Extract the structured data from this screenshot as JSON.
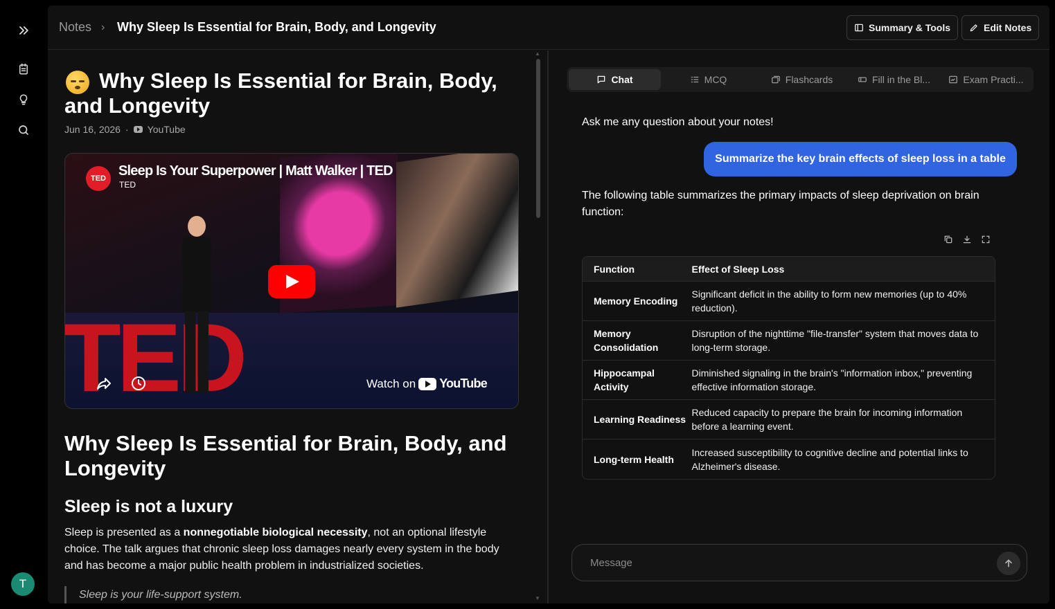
{
  "nav": {
    "icons": [
      "chevrons-right-icon",
      "notes-icon",
      "lightbulb-icon",
      "search-icon"
    ],
    "avatar_initial": "T"
  },
  "header": {
    "breadcrumb_root": "Notes",
    "breadcrumb_sep": "›",
    "breadcrumb_title": "Why Sleep Is Essential for Brain, Body, and Longevity",
    "summary_button": "Summary & Tools",
    "edit_button": "Edit Notes"
  },
  "note": {
    "title": "Why Sleep Is Essential for Brain, Body, and Longevity",
    "date": "Jun 16, 2026",
    "dot": "·",
    "source": "YouTube",
    "video": {
      "title": "Sleep Is Your Superpower | Matt Walker | TED",
      "channel": "TED",
      "logo": "TED",
      "stage_text": "TED",
      "watch_on": "Watch on",
      "youtube": "YouTube"
    },
    "heading": "Why Sleep Is Essential for Brain, Body, and Longevity",
    "subheading": "Sleep is not a luxury",
    "para_pre": "Sleep is presented as a ",
    "para_bold": "nonnegotiable biological necessity",
    "para_post": ", not an optional lifestyle choice. The talk argues that chronic sleep loss damages nearly every system in the body and has become a major public health problem in industrialized societies.",
    "quote": "Sleep is your life-support system."
  },
  "tools": {
    "tabs": [
      {
        "label": "Chat",
        "icon": "chat-icon",
        "active": true
      },
      {
        "label": "MCQ",
        "icon": "list-icon",
        "active": false
      },
      {
        "label": "Flashcards",
        "icon": "cards-icon",
        "active": false
      },
      {
        "label": "Fill in the Bl...",
        "icon": "blank-icon",
        "active": false
      },
      {
        "label": "Exam Practi...",
        "icon": "exam-icon",
        "active": false
      }
    ],
    "chat": {
      "prompt": "Ask me any question about your notes!",
      "user_message": "Summarize the key brain effects of sleep loss in a table",
      "answer": "The following table summarizes the primary impacts of sleep deprivation on brain function:",
      "table": {
        "headers": [
          "Function",
          "Effect of Sleep Loss"
        ],
        "rows": [
          [
            "Memory Encoding",
            "Significant deficit in the ability to form new memories (up to 40% reduction)."
          ],
          [
            "Memory Consolidation",
            "Disruption of the nighttime \"file-transfer\" system that moves data to long-term storage."
          ],
          [
            "Hippocampal Activity",
            "Diminished signaling in the brain's \"information inbox,\" preventing effective information storage."
          ],
          [
            "Learning Readiness",
            "Reduced capacity to prepare the brain for incoming information before a learning event."
          ],
          [
            "Long-term Health",
            "Increased susceptibility to cognitive decline and potential links to Alzheimer's disease."
          ]
        ]
      },
      "message_placeholder": "Message"
    }
  },
  "colors": {
    "accent": "#3164e1",
    "avatar": "#1a8a73",
    "youtube_red": "#ff0000",
    "ted_red": "#e11d28"
  }
}
